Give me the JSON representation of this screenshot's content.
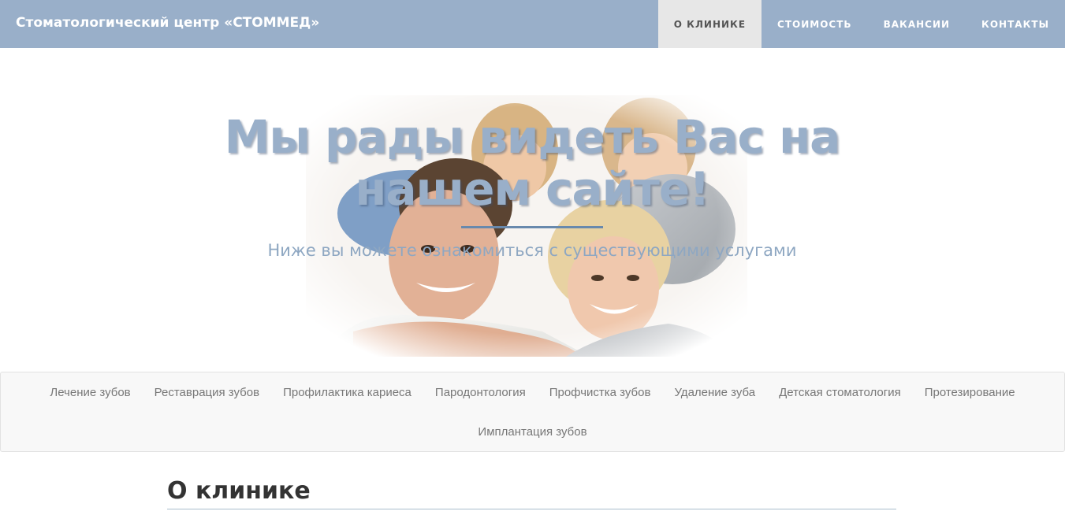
{
  "navbar": {
    "brand": "Стоматологический центр «СТОММЕД»",
    "items": [
      {
        "label": "О клинике",
        "active": true
      },
      {
        "label": "Стоимость",
        "active": false
      },
      {
        "label": "Вакансии",
        "active": false
      },
      {
        "label": "Контакты",
        "active": false
      }
    ]
  },
  "hero": {
    "title_line1": "Мы рады видеть Вас на",
    "title_line2": "нашем сайте!",
    "subtitle": "Ниже вы можете ознакомиться с существующими услугами",
    "image": "family-photo"
  },
  "services": {
    "row1": [
      "Лечение зубов",
      "Реставрация зубов",
      "Профилактика кариеса",
      "Пародонтология",
      "Профчистка зубов",
      "Удаление зуба",
      "Детская стоматология",
      "Протезирование"
    ],
    "row2": [
      "Имплантация зубов"
    ]
  },
  "about": {
    "heading": "О клинике"
  },
  "colors": {
    "navbar_bg": "#99afc9",
    "active_bg": "#e7e7e7",
    "hero_title": "#99afc9",
    "divider": "#6889ad",
    "services_bg": "#f8f8f8"
  }
}
